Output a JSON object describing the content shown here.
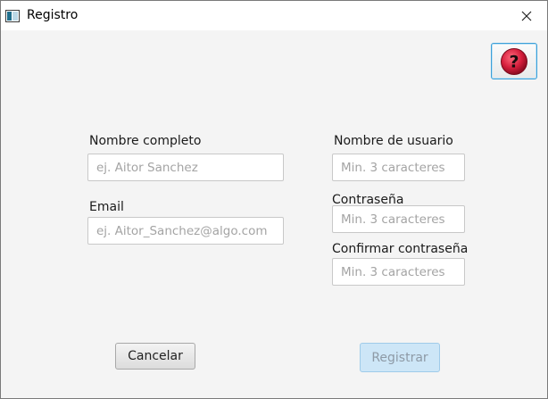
{
  "window": {
    "title": "Registro",
    "close_symbol": "✕",
    "app_icon": "window-app-icon"
  },
  "help": {
    "icon": "question-mark-icon",
    "symbol": "?"
  },
  "form": {
    "full_name": {
      "label": "Nombre completo",
      "placeholder": "ej. Aitor Sanchez",
      "value": ""
    },
    "email": {
      "label": "Email",
      "placeholder": "ej. Aitor_Sanchez@algo.com",
      "value": ""
    },
    "username": {
      "label": "Nombre de usuario",
      "placeholder": "Min. 3 caracteres",
      "value": ""
    },
    "password": {
      "label": "Contraseña",
      "placeholder": "Min. 3 caracteres",
      "value": ""
    },
    "confirm_password": {
      "label": "Confirmar contraseña",
      "placeholder": "Min. 3 caracteres",
      "value": ""
    }
  },
  "buttons": {
    "cancel": "Cancelar",
    "register": "Registrar"
  },
  "colors": {
    "accent": "#3b9fd8",
    "help_icon": "#d61e3c",
    "disabled_button": "#cde6f7"
  }
}
